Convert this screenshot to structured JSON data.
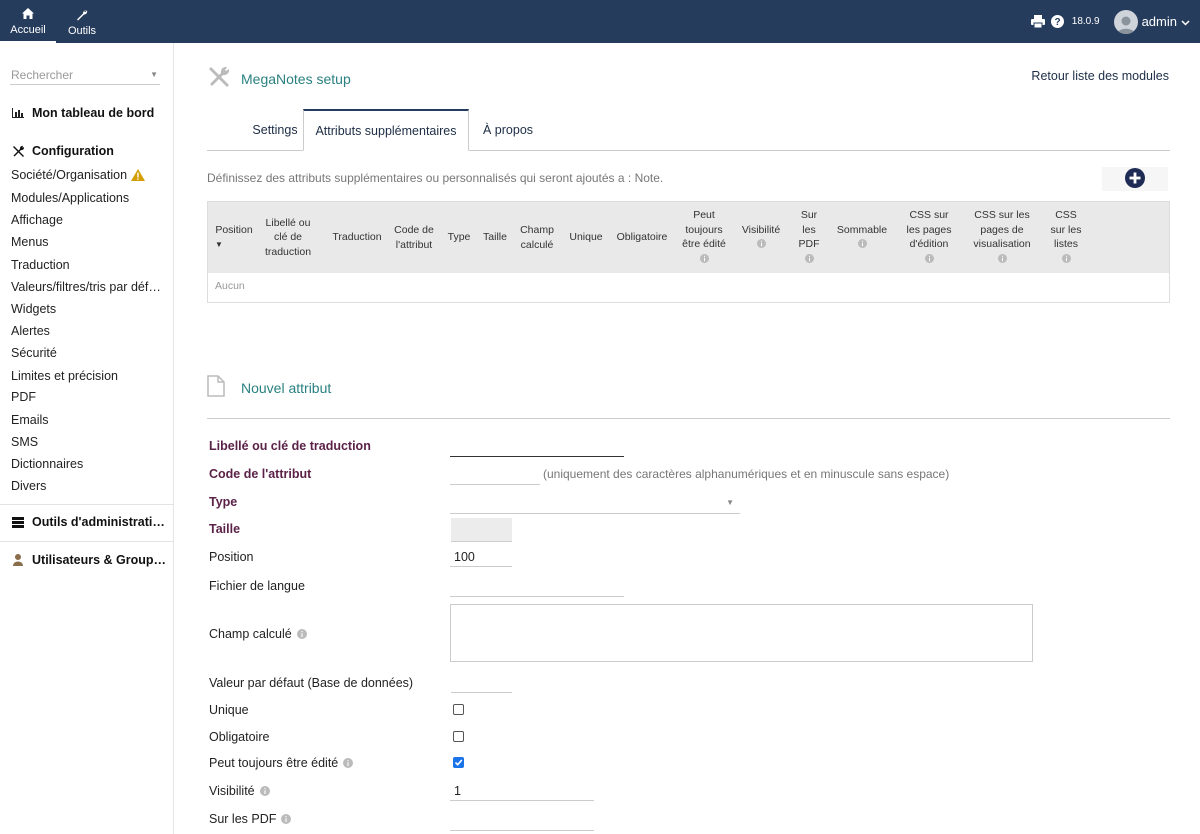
{
  "topbar": {
    "nav": [
      {
        "label": "Accueil",
        "icon": "home-icon"
      },
      {
        "label": "Outils",
        "icon": "wrench-icon"
      }
    ],
    "version": "18.0.9",
    "user": "admin"
  },
  "sidebar": {
    "search_placeholder": "Rechercher",
    "dashboard": "Mon tableau de bord",
    "config_head": "Configuration",
    "items": [
      "Société/Organisation",
      "Modules/Applications",
      "Affichage",
      "Menus",
      "Traduction",
      "Valeurs/filtres/tris par déf…",
      "Widgets",
      "Alertes",
      "Sécurité",
      "Limites et précision",
      "PDF",
      "Emails",
      "SMS",
      "Dictionnaires",
      "Divers"
    ],
    "admin_tools": "Outils d'administrati…",
    "users_groups": "Utilisateurs & Group…"
  },
  "header": {
    "title": "MegaNotes setup",
    "back_link": "Retour liste des modules"
  },
  "tabs": [
    "Settings",
    "Attributs supplémentaires",
    "À propos"
  ],
  "description": "Définissez des attributs supplémentaires ou personnalisés qui seront ajoutés a : Note.",
  "table": {
    "columns": [
      {
        "label": "Position",
        "sort": true
      },
      {
        "label": "Libellé ou\nclé de\ntraduction"
      },
      {
        "label": "Traduction"
      },
      {
        "label": "Code de\nl'attribut"
      },
      {
        "label": "Type"
      },
      {
        "label": "Taille"
      },
      {
        "label": "Champ\ncalculé"
      },
      {
        "label": "Unique"
      },
      {
        "label": "Obligatoire"
      },
      {
        "label": "Peut\ntoujours\nêtre édité",
        "info": true
      },
      {
        "label": "Visibilité",
        "info": true
      },
      {
        "label": "Sur\nles\nPDF",
        "info": true
      },
      {
        "label": "Sommable",
        "info": true
      },
      {
        "label": "CSS sur\nles pages\nd'édition",
        "info": true
      },
      {
        "label": "CSS sur les\npages de\nvisualisation",
        "info": true
      },
      {
        "label": "CSS\nsur les\nlistes",
        "info": true
      }
    ],
    "empty": "Aucun"
  },
  "form": {
    "title": "Nouvel attribut",
    "label_field": "Libellé ou clé de traduction",
    "code_field": "Code de l'attribut",
    "code_hint": "(uniquement des caractères alphanumériques et en minuscule sans espace)",
    "type_field": "Type",
    "size_field": "Taille",
    "position_field": "Position",
    "position_value": "100",
    "lang_field": "Fichier de langue",
    "computed_field": "Champ calculé",
    "default_field": "Valeur par défaut (Base de données)",
    "unique_field": "Unique",
    "required_field": "Obligatoire",
    "always_edit_field": "Peut toujours être édité",
    "visibility_field": "Visibilité",
    "visibility_value": "1",
    "pdf_field": "Sur les PDF"
  },
  "colors": {
    "topbar": "#263c5c",
    "title": "#2a8080",
    "required": "#5b2248",
    "checked": "#1a73e8"
  }
}
